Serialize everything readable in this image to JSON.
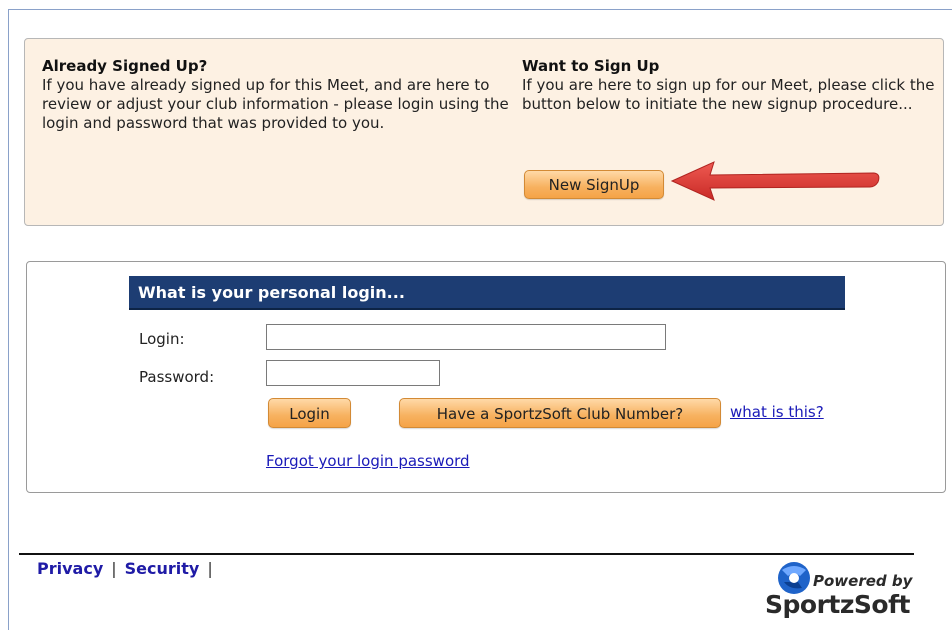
{
  "signup": {
    "left_title": "Already Signed Up?",
    "left_text": "If you have already signed up for this Meet, and are here to review or adjust your club information - please login using the login and password that was provided to you.",
    "right_title": "Want to Sign Up",
    "right_text": "If you are here to sign up for our Meet, please click the button below to initiate the new signup procedure...",
    "new_signup_label": "New SignUp"
  },
  "login": {
    "header": "What is your personal login...",
    "login_label": "Login:",
    "password_label": "Password:",
    "login_value": "",
    "password_value": "",
    "login_button": "Login",
    "club_number_button": "Have a SportzSoft Club Number?",
    "what_is_this_link": "what is this?",
    "forgot_link": "Forgot your login password"
  },
  "footer": {
    "privacy": "Privacy",
    "security": "Security",
    "separator": "|",
    "powered_by": "Powered by",
    "brand": "SportzSoft"
  },
  "colors": {
    "panel_bg": "#fdf1e3",
    "header_bg": "#1d3d73",
    "button_orange": "#f7b15f",
    "arrow_red": "#e03a36",
    "link_blue": "#1a1ab8"
  },
  "icons": {
    "arrow": "red-left-arrow",
    "logo": "sportzsoft-logo"
  }
}
